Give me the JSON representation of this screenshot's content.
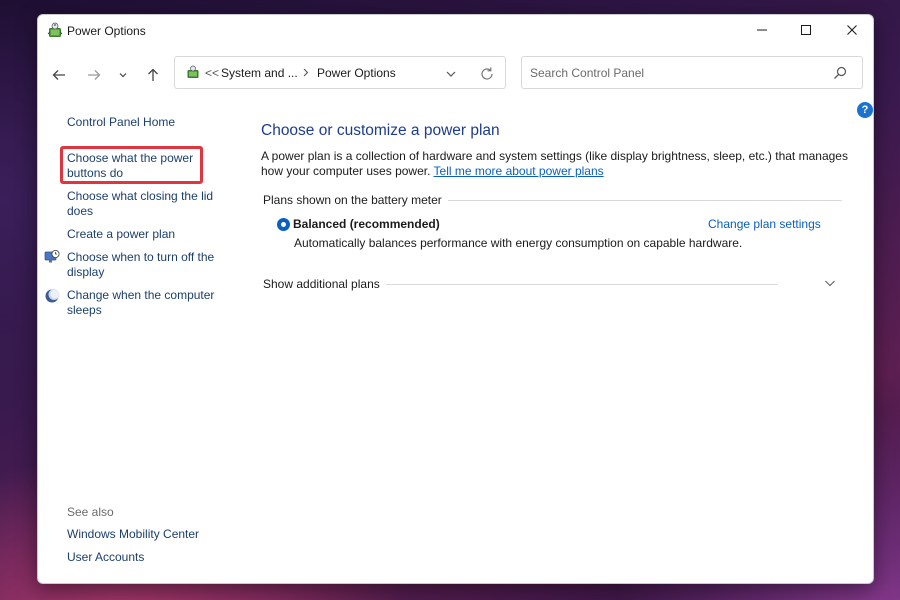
{
  "window": {
    "title": "Power Options"
  },
  "address_bar": {
    "overflow": "<<",
    "segments": [
      "System and ...",
      "Power Options"
    ]
  },
  "search": {
    "placeholder": "Search Control Panel"
  },
  "help": {
    "label": "?"
  },
  "sidebar": {
    "home": "Control Panel Home",
    "items": [
      {
        "line1": "Choose what the power",
        "line2": "buttons do",
        "highlighted": true
      },
      {
        "line1": "Choose what closing the lid",
        "line2": "does"
      },
      {
        "line1": "Create a power plan",
        "line2": ""
      },
      {
        "line1": "Choose when to turn off the",
        "line2": "display",
        "icon": "monitor-clock-icon"
      },
      {
        "line1": "Change when the computer",
        "line2": "sleeps",
        "icon": "moon-sleep-icon"
      }
    ],
    "see_also": {
      "heading": "See also",
      "links": [
        "Windows Mobility Center",
        "User Accounts"
      ]
    }
  },
  "main": {
    "title": "Choose or customize a power plan",
    "description": "A power plan is a collection of hardware and system settings (like display brightness, sleep, etc.) that manages how your computer uses power.",
    "description_link": "Tell me more about power plans",
    "plans_section": "Plans shown on the battery meter",
    "plan": {
      "name": "Balanced (recommended)",
      "description": "Automatically balances performance with energy consumption on capable hardware.",
      "selected": true,
      "settings_link": "Change plan settings"
    },
    "additional_plans": "Show additional plans"
  },
  "colors": {
    "link": "#1b3f6b",
    "accent_link": "#0b5fbf",
    "title": "#1e3c8f",
    "highlight_border": "#e0343e"
  }
}
